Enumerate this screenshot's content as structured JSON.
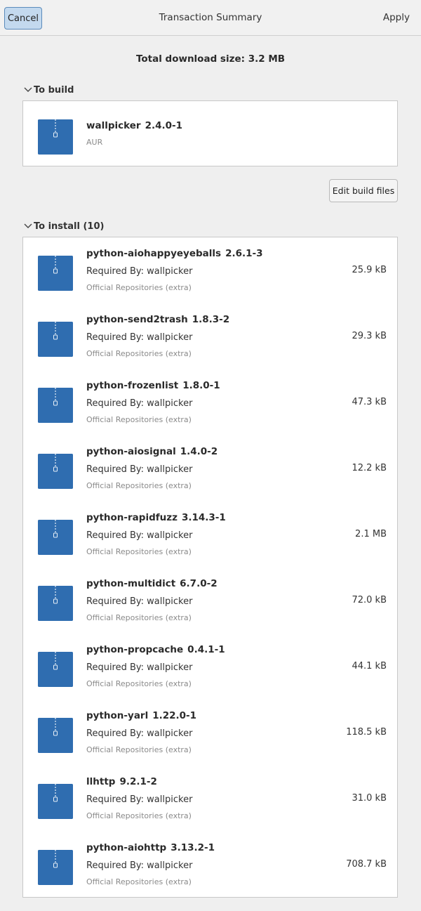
{
  "header": {
    "cancel_label": "Cancel",
    "title": "Transaction Summary",
    "apply_label": "Apply"
  },
  "summary": {
    "total_download": "Total download size: 3.2 MB"
  },
  "build": {
    "heading": "To build",
    "package": {
      "name": "wallpicker",
      "version": "2.4.0-1",
      "source": "AUR"
    },
    "edit_button_label": "Edit build files"
  },
  "install": {
    "heading": "To install (10)",
    "packages": [
      {
        "name": "python-aiohappyeyeballs",
        "version": "2.6.1-3",
        "required_by": "Required By: wallpicker",
        "repo": "Official Repositories (extra)",
        "size": "25.9 kB"
      },
      {
        "name": "python-send2trash",
        "version": "1.8.3-2",
        "required_by": "Required By: wallpicker",
        "repo": "Official Repositories (extra)",
        "size": "29.3 kB"
      },
      {
        "name": "python-frozenlist",
        "version": "1.8.0-1",
        "required_by": "Required By: wallpicker",
        "repo": "Official Repositories (extra)",
        "size": "47.3 kB"
      },
      {
        "name": "python-aiosignal",
        "version": "1.4.0-2",
        "required_by": "Required By: wallpicker",
        "repo": "Official Repositories (extra)",
        "size": "12.2 kB"
      },
      {
        "name": "python-rapidfuzz",
        "version": "3.14.3-1",
        "required_by": "Required By: wallpicker",
        "repo": "Official Repositories (extra)",
        "size": "2.1 MB"
      },
      {
        "name": "python-multidict",
        "version": "6.7.0-2",
        "required_by": "Required By: wallpicker",
        "repo": "Official Repositories (extra)",
        "size": "72.0 kB"
      },
      {
        "name": "python-propcache",
        "version": "0.4.1-1",
        "required_by": "Required By: wallpicker",
        "repo": "Official Repositories (extra)",
        "size": "44.1 kB"
      },
      {
        "name": "python-yarl",
        "version": "1.22.0-1",
        "required_by": "Required By: wallpicker",
        "repo": "Official Repositories (extra)",
        "size": "118.5 kB"
      },
      {
        "name": "llhttp",
        "version": "9.2.1-2",
        "required_by": "Required By: wallpicker",
        "repo": "Official Repositories (extra)",
        "size": "31.0 kB"
      },
      {
        "name": "python-aiohttp",
        "version": "3.13.2-1",
        "required_by": "Required By: wallpicker",
        "repo": "Official Repositories (extra)",
        "size": "708.7 kB"
      }
    ]
  },
  "icons": {
    "package": "package-archive-icon",
    "expander": "chevron-down-icon"
  },
  "colors": {
    "accent": "#2f6db0",
    "cancel_bg": "#c3d9ee",
    "cancel_border": "#5b8bbb"
  }
}
